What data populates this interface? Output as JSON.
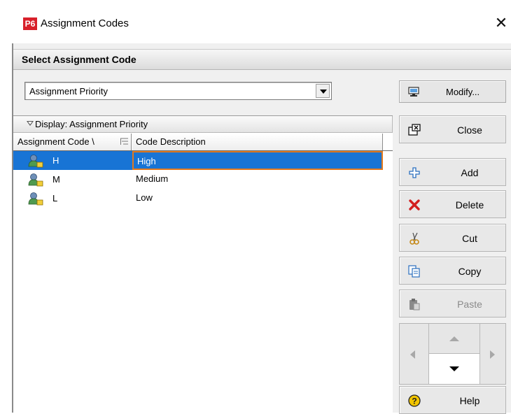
{
  "window": {
    "app_badge": "P6",
    "title": "Assignment Codes"
  },
  "header": {
    "title": "Select Assignment Code"
  },
  "selector": {
    "value": "Assignment Priority",
    "modify_label": "Modify..."
  },
  "list": {
    "group_label": "Display: Assignment Priority",
    "columns": [
      "Assignment Code \\",
      "Code Description"
    ],
    "rows": [
      {
        "code": "H",
        "description": "High",
        "selected": true
      },
      {
        "code": "M",
        "description": "Medium",
        "selected": false
      },
      {
        "code": "L",
        "description": "Low",
        "selected": false
      }
    ]
  },
  "buttons": {
    "close": "Close",
    "add": "Add",
    "delete": "Delete",
    "cut": "Cut",
    "copy": "Copy",
    "paste": "Paste",
    "help": "Help"
  },
  "colors": {
    "selection": "#1874d5",
    "focus_border": "#e27a1f",
    "delete_icon": "#d21f1f",
    "add_icon": "#2a6fbf",
    "help_icon": "#f2c500"
  }
}
